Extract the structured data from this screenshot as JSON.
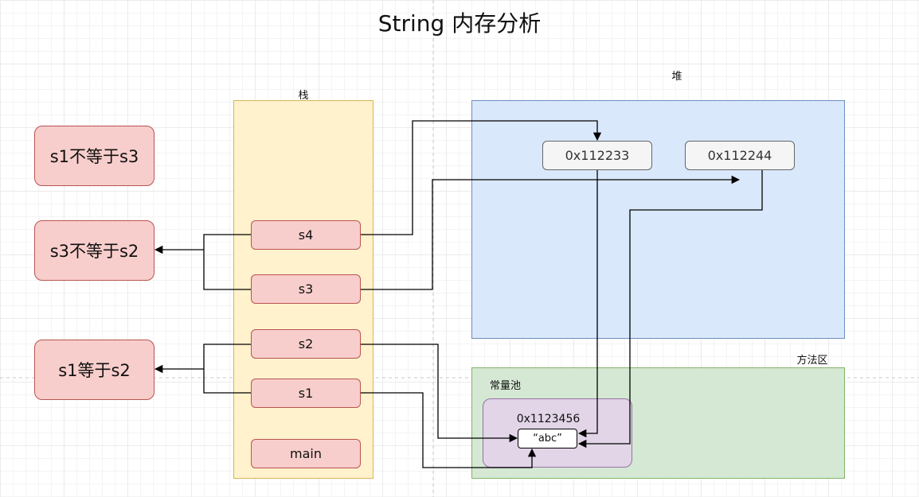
{
  "title": "String 内存分析",
  "regions": {
    "stack_label": "栈",
    "heap_label": "堆",
    "method_area_label": "方法区",
    "constant_pool_label": "常量池"
  },
  "stack_cells": [
    "s4",
    "s3",
    "s2",
    "s1",
    "main"
  ],
  "heap_objects": [
    "0x112233",
    "0x112244"
  ],
  "constant_pool": {
    "address": "0x1123456",
    "value": "“abc”"
  },
  "notes": [
    "s1不等于s3",
    "s3不等于s2",
    "s1等于s2"
  ],
  "colors": {
    "stack_fill": "#fff2cc",
    "heap_fill": "#dae8fc",
    "method_fill": "#d5e8d4",
    "pool_fill": "#e1d5e7",
    "cell_fill": "#f8cecc",
    "heap_box_fill": "#f5f5f5"
  }
}
